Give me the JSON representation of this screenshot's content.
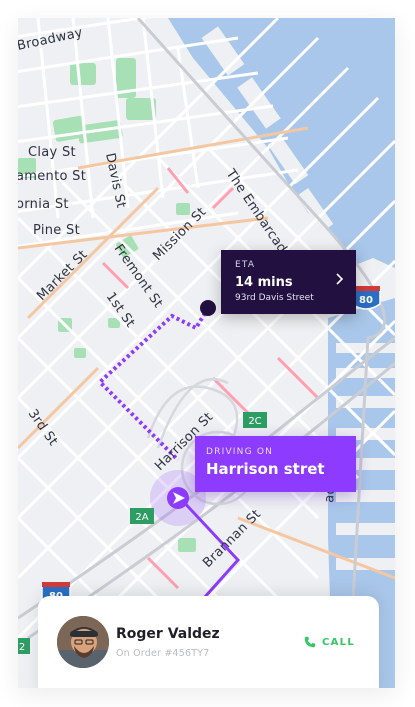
{
  "map": {
    "street_labels": {
      "broadway": "Broadway",
      "clay": "Clay St",
      "sacramento": "amento St",
      "california": "ornia St",
      "pine": "Pine St",
      "davis": "Davis St",
      "embarcadero_top": "The Embarcad",
      "embarcadero_bottom": "adero",
      "mission": "Mission St",
      "market": "Market St",
      "fremont": "Fremont St",
      "first": "1st St",
      "third": "3rd St",
      "harrison": "Harrison St",
      "brannan": "Brannan St"
    },
    "highway_badges": {
      "h80_top": "80",
      "h80_bottom": "80",
      "exit_2c": "2C",
      "exit_2a": "2A",
      "exit_2": "2"
    },
    "colors": {
      "route_purple": "#8c3bff",
      "water": "#a9c7ea",
      "park": "#a8e0b6"
    }
  },
  "eta": {
    "label": "ETA",
    "time": "14 mins",
    "address": "93rd Davis Street"
  },
  "driving": {
    "label": "DRIVING ON",
    "street": "Harrison stret"
  },
  "driver": {
    "name": "Roger Valdez",
    "order": "On Order #456TY7",
    "call_label": "CALL"
  },
  "icons": {
    "eta_chevron": "chevron-right-icon",
    "location_arrow": "navigation-arrow-icon",
    "destination": "destination-dot-icon",
    "phone": "phone-icon"
  }
}
